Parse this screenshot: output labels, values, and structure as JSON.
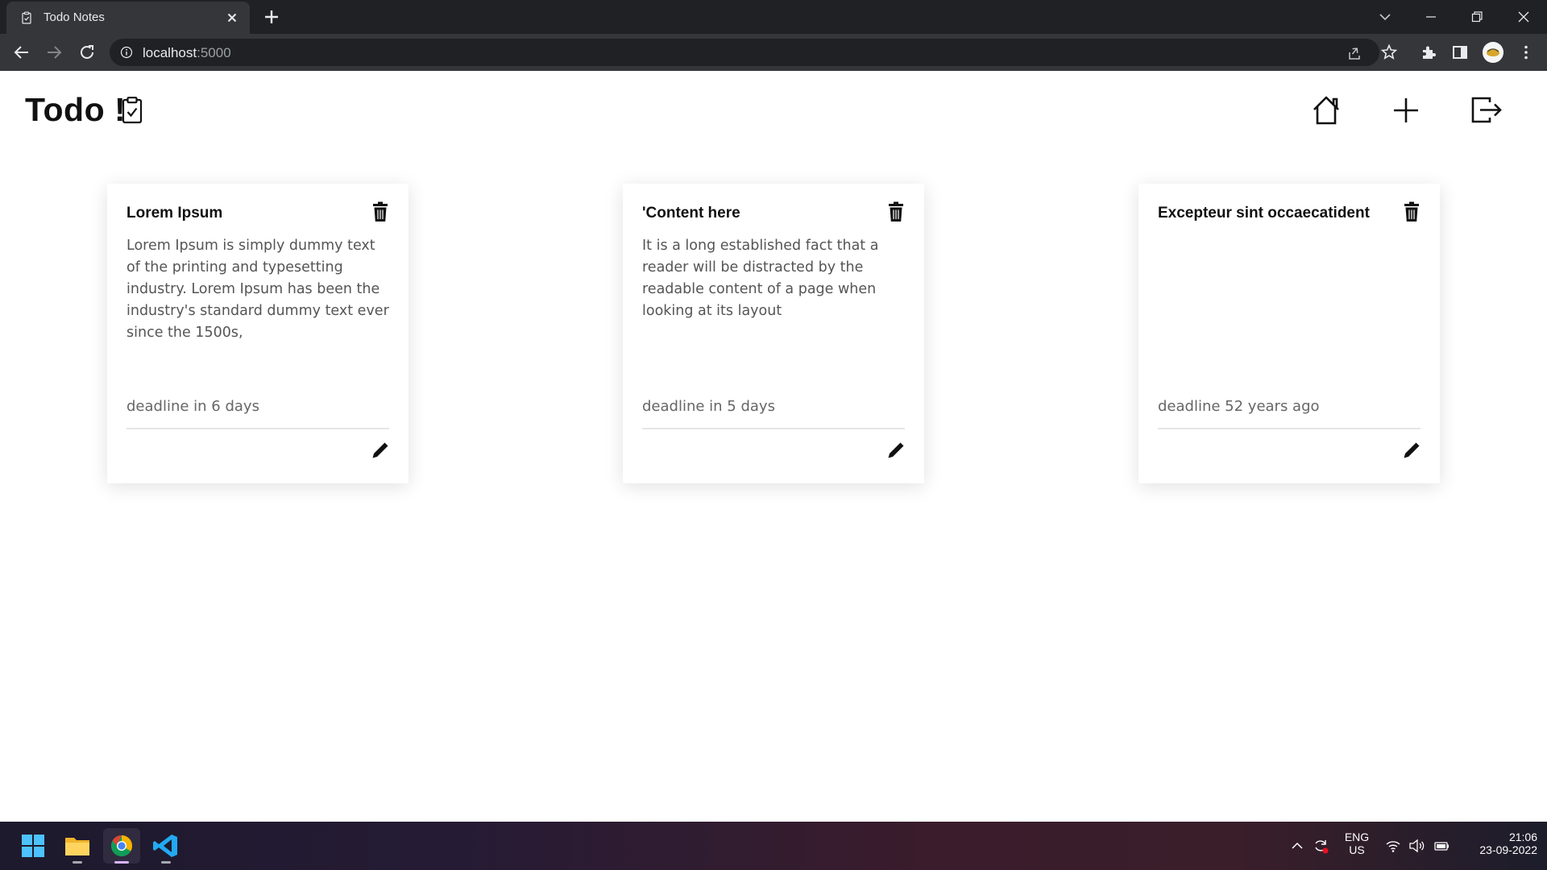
{
  "browser": {
    "tab_title": "Todo Notes",
    "url_host": "localhost",
    "url_port": ":5000"
  },
  "app": {
    "brand": "Todo !",
    "nav": {
      "home_icon": "home-icon",
      "add_icon": "plus-icon",
      "logout_icon": "logout-icon"
    }
  },
  "notes": [
    {
      "title": "Lorem Ipsum",
      "body": "Lorem Ipsum is simply dummy text of the printing and typesetting industry. Lorem Ipsum has been the industry's standard dummy text ever since the 1500s,",
      "deadline": "deadline in 6 days"
    },
    {
      "title": "'Content here",
      "body": "It is a long established fact that a reader will be distracted by the readable content of a page when looking at its layout",
      "deadline": "deadline in 5 days"
    },
    {
      "title": "Excepteur sint occaecatident",
      "body": "",
      "deadline": "deadline 52 years ago"
    }
  ],
  "taskbar": {
    "lang_top": "ENG",
    "lang_bottom": "US",
    "time": "21:06",
    "date": "23-09-2022"
  }
}
